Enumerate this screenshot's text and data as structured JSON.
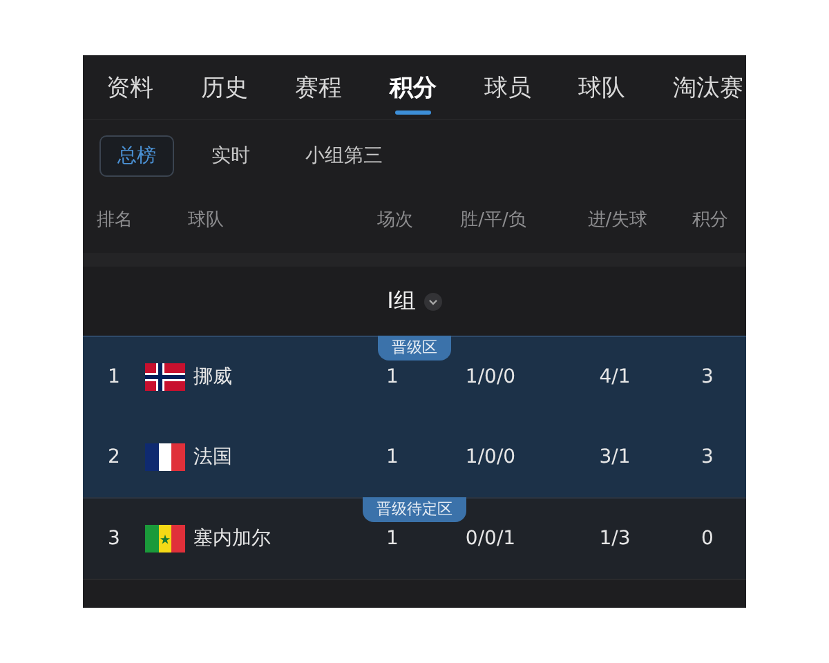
{
  "tabs": [
    {
      "label": "资料",
      "selected": false
    },
    {
      "label": "历史",
      "selected": false
    },
    {
      "label": "赛程",
      "selected": false
    },
    {
      "label": "积分",
      "selected": true
    },
    {
      "label": "球员",
      "selected": false
    },
    {
      "label": "球队",
      "selected": false
    },
    {
      "label": "淘汰赛",
      "selected": false
    }
  ],
  "subtabs": [
    {
      "label": "总榜",
      "selected": true
    },
    {
      "label": "实时",
      "selected": false
    },
    {
      "label": "小组第三",
      "selected": false
    }
  ],
  "columns": [
    "排名",
    "球队",
    "场次",
    "胜/平/负",
    "进/失球",
    "积分"
  ],
  "group": {
    "title": "I组"
  },
  "zones": [
    {
      "label": "晋级区",
      "kind": "promoted",
      "rows": [
        {
          "rank": "1",
          "flag": {
            "kind": "norway"
          },
          "team": "挪威",
          "played": "1",
          "wdl": "1/0/0",
          "goals": "4/1",
          "points": "3"
        },
        {
          "rank": "2",
          "flag": {
            "kind": "france"
          },
          "team": "法国",
          "played": "1",
          "wdl": "1/0/0",
          "goals": "3/1",
          "points": "3"
        }
      ]
    },
    {
      "label": "晋级待定区",
      "kind": "pending",
      "rows": [
        {
          "rank": "3",
          "flag": {
            "kind": "senegal"
          },
          "team": "塞内加尔",
          "played": "1",
          "wdl": "0/0/1",
          "goals": "1/3",
          "points": "0"
        }
      ]
    }
  ]
}
